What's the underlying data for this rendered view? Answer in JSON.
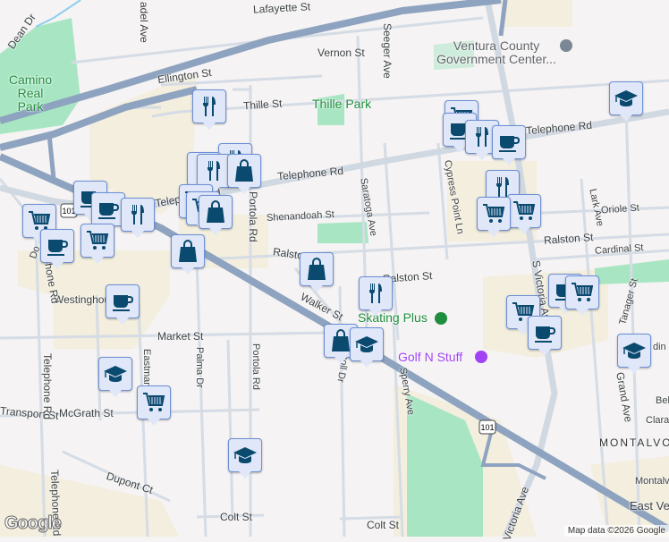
{
  "map": {
    "streets": {
      "lafayette": "Lafayette St",
      "dean": "Dean Dr",
      "adel": "adel Ave",
      "ellington": "Ellington St",
      "thille": "Thille St",
      "vernon": "Vernon St",
      "seeger": "Seeger Ave",
      "telephone_top": "Telephone Rd",
      "telephone_mid": "Telephone Rd",
      "teleph_left": "Telephone Rd",
      "portola_top": "Portola Rd",
      "shenandoah": "Shenandoah St",
      "ralston_left": "Ralston St",
      "ralston_mid": "Ralston St",
      "ralston_right": "Ralston St",
      "saratoga": "Saratoga Ave",
      "cypress": "Cypress Point Ln",
      "lark": "Lark Ave",
      "oriole": "Oriole St",
      "cardinal": "Cardinal St",
      "victoria_top": "S Victoria Ave",
      "victoria_bottom": "Victoria Ave",
      "westinghouse": "Westinghouse St",
      "walker": "Walker St",
      "market": "Market St",
      "eastman": "Eastman Ave",
      "palma": "Palma Dr",
      "portola_bottom": "Portola Rd",
      "knoll": "Knoll Dr",
      "sperry": "Sperry Ave",
      "mcgrath": "McGrath St",
      "transport": "Transport St",
      "telephone_vert": "Telephone Rd",
      "dupont": "Dupont Ct",
      "colt_left": "Colt St",
      "colt_right": "Colt St",
      "grand": "Grand Ave",
      "tanager": "Tanager St",
      "bel": "Bel",
      "clara": "Clara",
      "montalvo_st": "Montalvo",
      "east_ve": "East Ve",
      "do": "Do",
      "franklin": "din St"
    },
    "places": {
      "camino_real_park": "Camino Real Park",
      "thille_park": "Thille Park",
      "gov_center": "Ventura County Government Center...",
      "skating_plus": "Skating Plus",
      "golf_n_stuff": "Golf N Stuff",
      "montalvo": "MONTALVO"
    },
    "highway_shield": "101",
    "attribution": "Map data ©2026 Google",
    "logo": "Google"
  },
  "colors": {
    "marker_fill": "#dfe7f8",
    "marker_border": "#6c8fd6",
    "marker_icon": "#0b4a6f",
    "highway": "#8ea3bf",
    "park": "#a8e6c3",
    "commercial": "#f3eedd",
    "poi_green": "#1e8e3e",
    "poi_purple": "#a142f4"
  }
}
